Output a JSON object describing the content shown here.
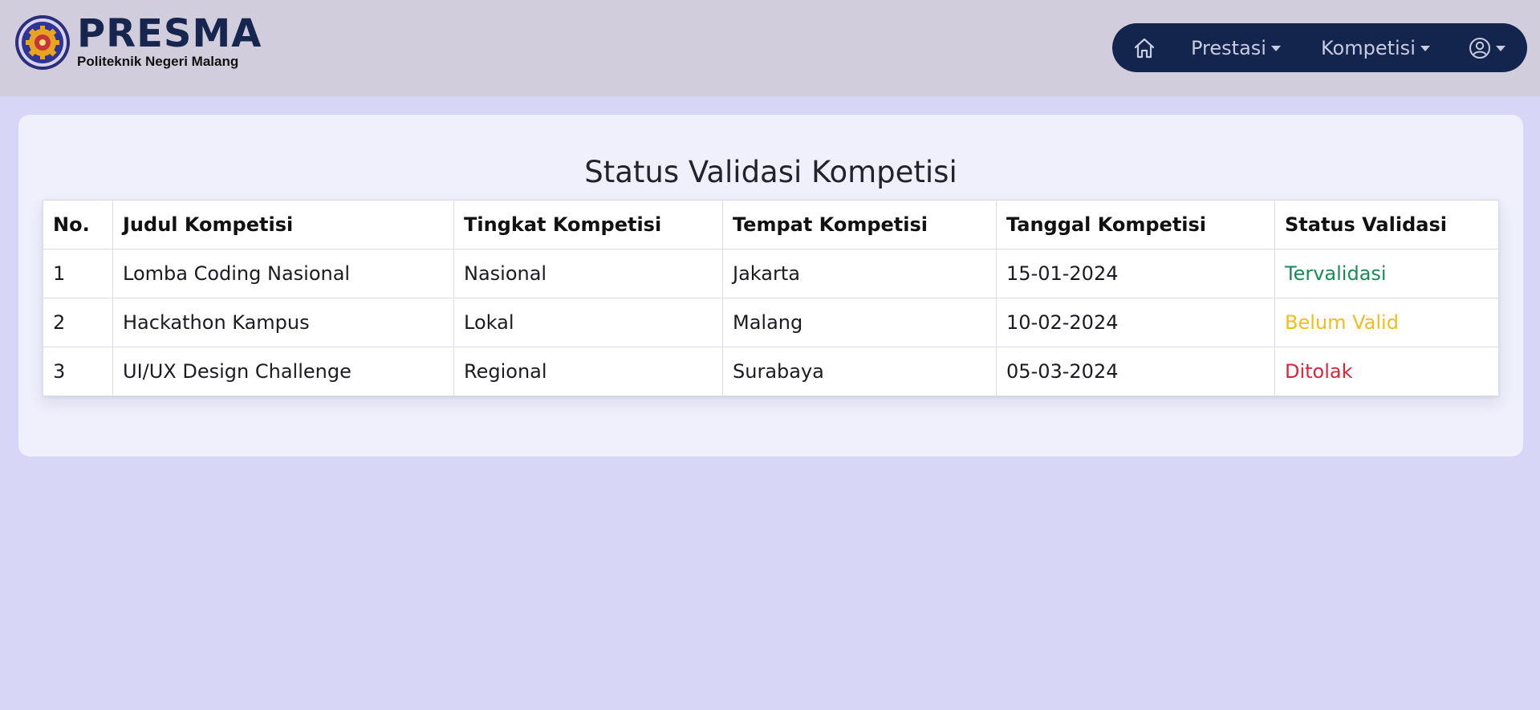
{
  "header": {
    "brand_title": "PRESMA",
    "brand_subtitle": "Politeknik Negeri Malang",
    "nav": {
      "prestasi_label": "Prestasi",
      "kompetisi_label": "Kompetisi"
    }
  },
  "main": {
    "title": "Status Validasi Kompetisi",
    "table": {
      "headers": [
        "No.",
        "Judul Kompetisi",
        "Tingkat Kompetisi",
        "Tempat Kompetisi",
        "Tanggal Kompetisi",
        "Status Validasi"
      ],
      "rows": [
        [
          "1",
          "Lomba Coding Nasional",
          "Nasional",
          "Jakarta",
          "15-01-2024",
          "Tervalidasi"
        ],
        [
          "2",
          "Hackathon Kampus",
          "Lokal",
          "Malang",
          "10-02-2024",
          "Belum Valid"
        ],
        [
          "3",
          "UI/UX Design Challenge",
          "Regional",
          "Surabaya",
          "05-03-2024",
          "Ditolak"
        ]
      ]
    }
  },
  "colors": {
    "page_background": "#d8d6f6",
    "header_background": "#d2cddc",
    "nav_background": "#13244d",
    "card_background": "#eff0fc",
    "status_validated": "#1a8a56",
    "status_pending": "#f2bd1c",
    "status_rejected": "#d2283c"
  },
  "icons": {
    "logo": "polinema-logo",
    "home": "home-icon",
    "profile": "user-circle-icon",
    "caret": "caret-down-icon"
  }
}
